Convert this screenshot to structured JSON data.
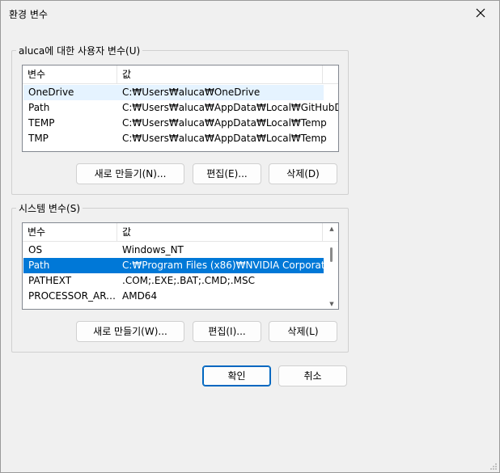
{
  "window": {
    "title": "환경 변수"
  },
  "user_group": {
    "label": "aluca에 대한 사용자 변수(U)",
    "columns": [
      "변수",
      "값"
    ],
    "rows": [
      {
        "name": "OneDrive",
        "value": "C:₩Users₩aluca₩OneDrive"
      },
      {
        "name": "Path",
        "value": "C:₩Users₩aluca₩AppData₩Local₩GitHubD..."
      },
      {
        "name": "TEMP",
        "value": "C:₩Users₩aluca₩AppData₩Local₩Temp"
      },
      {
        "name": "TMP",
        "value": "C:₩Users₩aluca₩AppData₩Local₩Temp"
      }
    ],
    "buttons": {
      "new": "새로 만들기(N)...",
      "edit": "편집(E)...",
      "delete": "삭제(D)"
    }
  },
  "system_group": {
    "label": "시스템 변수(S)",
    "columns": [
      "변수",
      "값"
    ],
    "rows": [
      {
        "name": "OS",
        "value": "Windows_NT"
      },
      {
        "name": "Path",
        "value": "C:₩Program Files (x86)₩NVIDIA Corporati..."
      },
      {
        "name": "PATHEXT",
        "value": ".COM;.EXE;.BAT;.CMD;.MSC"
      },
      {
        "name": "PROCESSOR_ARC...",
        "value": "AMD64"
      }
    ],
    "buttons": {
      "new": "새로 만들기(W)...",
      "edit": "편집(I)...",
      "delete": "삭제(L)"
    }
  },
  "footer": {
    "ok": "확인",
    "cancel": "취소"
  },
  "colors": {
    "selection": "#0078d7",
    "hover": "#e5f3ff",
    "primary_border": "#0067c0"
  }
}
